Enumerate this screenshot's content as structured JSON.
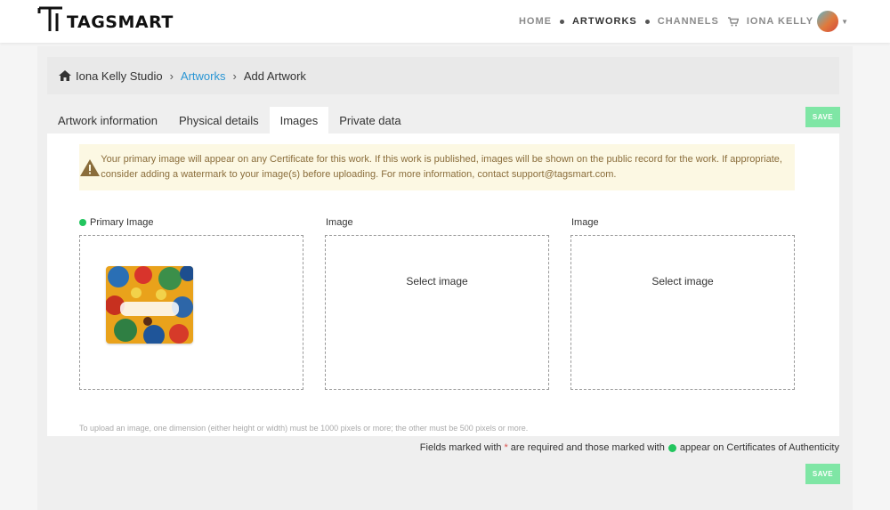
{
  "brand": {
    "name": "TAGSMART"
  },
  "nav": {
    "home": "HOME",
    "artworks": "ARTWORKS",
    "channels": "CHANNELS",
    "user_name": "IONA KELLY"
  },
  "breadcrumb": {
    "studio": "Iona Kelly Studio",
    "artworks": "Artworks",
    "current": "Add Artwork"
  },
  "tabs": [
    {
      "label": "Artwork information"
    },
    {
      "label": "Physical details"
    },
    {
      "label": "Images",
      "active": true
    },
    {
      "label": "Private data"
    }
  ],
  "actions": {
    "save_label": "SAVE"
  },
  "alert": {
    "text": "Your primary image will appear on any Certificate for this work. If this work is published, images will be shown on the public record for the work. If appropriate, consider adding a watermark to your image(s) before uploading. For more information, contact support@tagsmart.com."
  },
  "images": {
    "primary_label": "Primary Image",
    "slot2_label": "Image",
    "slot3_label": "Image",
    "select_text": "Select image"
  },
  "notes": {
    "upload": "To upload an image, one dimension (either height or width) must be 1000 pixels or more; the other must be 500 pixels or more.",
    "fields_part1": "Fields marked with",
    "fields_star": "*",
    "fields_part2": "are required and those marked with",
    "fields_part3": "appear on Certificates of Authenticity"
  },
  "colors": {
    "accent_link": "#2a96d4",
    "save_button": "#7fe6a5",
    "alert_bg": "#fcf8e3",
    "alert_text": "#8a6d3b",
    "certificate_dot": "#22c55e",
    "required_star": "#d9534f"
  },
  "icons": [
    "tagsmart-logo-icon",
    "cart-icon",
    "home-icon",
    "warning-icon",
    "chevron-right-icon",
    "caret-down-icon"
  ]
}
